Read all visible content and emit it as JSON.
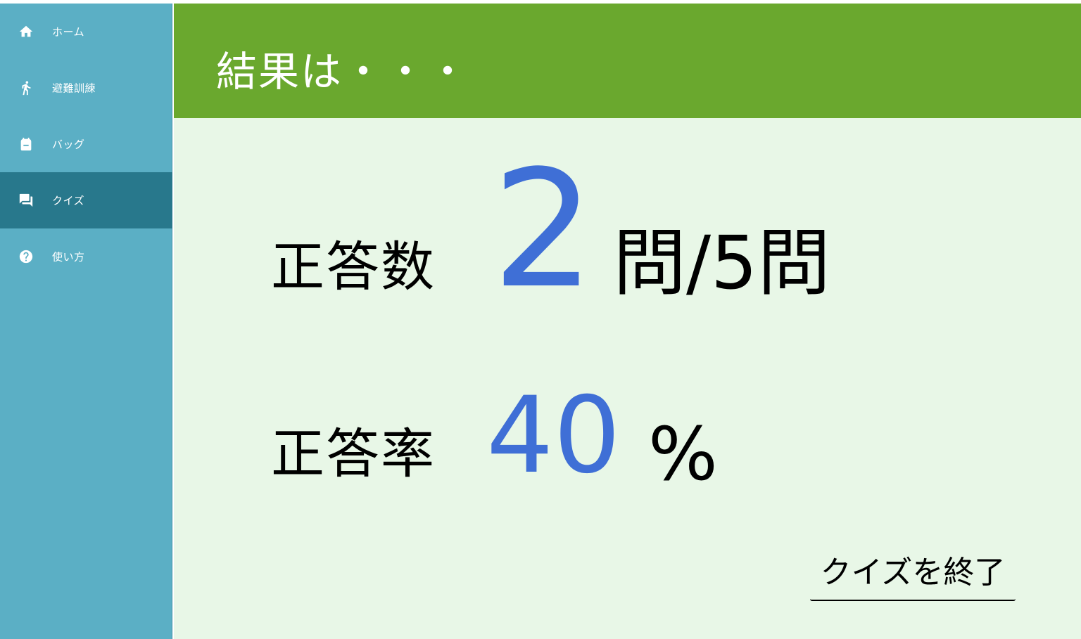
{
  "sidebar": {
    "items": [
      {
        "label": "ホーム",
        "icon": "home-icon"
      },
      {
        "label": "避難訓練",
        "icon": "running-person-icon"
      },
      {
        "label": "バッグ",
        "icon": "bag-icon"
      },
      {
        "label": "クイズ",
        "icon": "chat-bubbles-icon",
        "active": true
      },
      {
        "label": "使い方",
        "icon": "help-circle-icon"
      }
    ]
  },
  "header": {
    "title": "結果は・・・"
  },
  "result": {
    "correct_count_label": "正答数",
    "correct_count_value": "2",
    "correct_count_unit": "問/5問",
    "rate_label": "正答率",
    "rate_value": "40",
    "rate_unit": "%"
  },
  "actions": {
    "finish_label": "クイズを終了"
  },
  "colors": {
    "sidebar_bg": "#5bafc5",
    "sidebar_active": "#28788c",
    "header_bg": "#6aa82e",
    "main_bg": "#e8f7e7",
    "accent_number": "#3f6fd6"
  }
}
